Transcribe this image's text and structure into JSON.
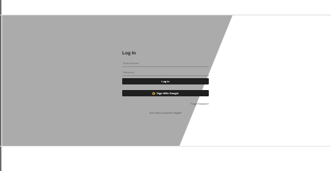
{
  "colors": {
    "panel": "#ababab",
    "button": "#1f1f1f",
    "google_icon": "#f2c94c"
  },
  "login": {
    "title": "Log In",
    "email_placeholder": "Email Address",
    "password_placeholder": "Password",
    "login_label": "Log In",
    "google_label": "Sign With Google",
    "google_icon": "google-icon",
    "forgot_label": "Forgot Password?",
    "register_prompt": "Don't have an account?",
    "register_label": "Register"
  }
}
